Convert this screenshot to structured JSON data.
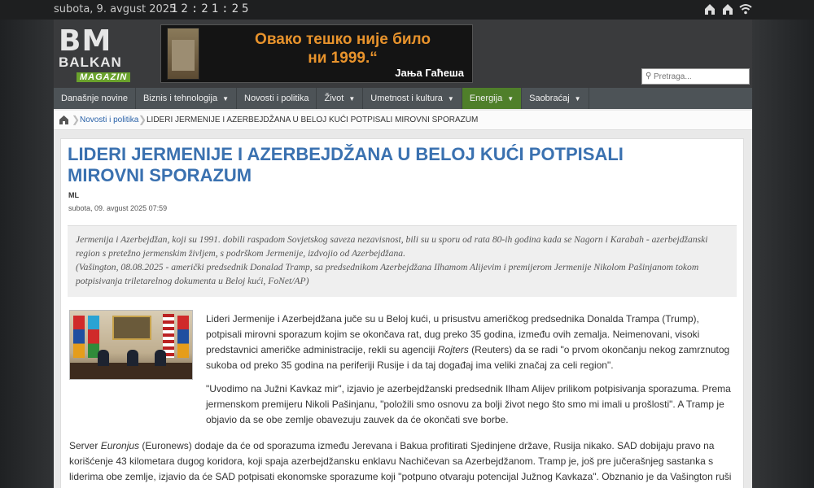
{
  "topbar": {
    "date": "subota, 9. avgust 2025",
    "clock": "12:21:25",
    "icons": [
      "sitemap-icon",
      "home-icon",
      "wifi-icon"
    ]
  },
  "logo": {
    "line1": "BM",
    "line2": "BALKAN",
    "line3": "MAGAZIN"
  },
  "banner": {
    "quote": "Овако тешко није било ни 1999.“",
    "author": "Јања Гаћеша"
  },
  "search": {
    "placeholder": "Pretraga..."
  },
  "nav": {
    "items": [
      {
        "label": "Današnje novine",
        "caret": false
      },
      {
        "label": "Biznis i tehnologija",
        "caret": true
      },
      {
        "label": "Novosti i politika",
        "caret": false
      },
      {
        "label": "Život",
        "caret": true
      },
      {
        "label": "Umetnost i kultura",
        "caret": true
      },
      {
        "label": "Energija",
        "caret": true
      },
      {
        "label": "Saobraćaj",
        "caret": true
      }
    ]
  },
  "breadcrumb": {
    "level1": "Novosti i politika",
    "level2": "LIDERI JERMENIJE I AZERBEJDŽANA U BELOJ KUĆI POTPISALI MIROVNI SPORAZUM"
  },
  "article": {
    "title": "LIDERI JERMENIJE I AZERBEJDŽANA U BELOJ KUĆI POTPISALI MIROVNI SPORAZUM",
    "author": "ML",
    "date": "subota, 09. avgust 2025 07:59",
    "lead": "Jermenija i Azerbejdžan, koji su 1991. dobili raspadom Sovjetskog saveza nezavisnost, bili su u sporu od rata 80-ih godina kada se Nagorn i Karabah - azerbejdžanski region s pretežno jermenskim življem, s podrškom Jermenije, izdvojio od Azerbejdžana.",
    "caption": "(Vašington, 08.08.2025 - američki predsednik Donalad Tramp, sa predsednikom Azerbejdžana Ilhamom Alijevim i premijerom Jermenije Nikolom Pašinjanom tokom potpisivanja triletarelnog dokumenta u Beloj kući, FoNet/AP)",
    "paragraph1_a": "Lideri Jermenije i Azerbejdžana juče su u Beloj kući, u prisustvu američkog predsednika Donalda Trampa (Trump), potpisali mirovni sporazum kojim se okončava rat, dug preko 35 godina, između ovih zemalja. Neimenovani, visoki predstavnici američke administracije, rekli su agenciji ",
    "paragraph1_em": "Rojters",
    "paragraph1_b": " (Reuters) da se radi \"o prvom okončanju nekog zamrznutog sukoba od preko 35 godina na periferiji Rusije i da taj događaj ima veliki značaj za celi region\".",
    "paragraph2": "\"Uvodimo na Južni Kavkaz mir\", izjavio je azerbejdžanski predsednik Ilham Alijev prilikom potpisivanja sporazuma. Prema jermenskom premijeru Nikoli Pašinjanu, \"položili smo osnovu za bolji život nego što smo mi imali u prošlosti\". A Tramp je objavio da se obe zemlje obavezuju zauvek da će okončati sve borbe.",
    "paragraph3_a": "Server ",
    "paragraph3_em": "Euronjus",
    "paragraph3_b": " (Euronews) dodaje da će od sporazuma između Jerevana i Bakua profitirati Sjedinjene države, Rusija nikako. SAD dobijaju pravo na korišćenje 43 kilometara dugog koridora, koji spaja azerbejdžansku enklavu Nachičevan sa Azerbejdžanom. Tramp je, još pre jučerašnjeg sastanka s liderima obe zemlje, izjavio da će SAD potpisati ekonomske sporazume koji \"potpuno otvaraju potencijal Južnog Kavkaza\". Obznanio je da Vašington ruši"
  }
}
